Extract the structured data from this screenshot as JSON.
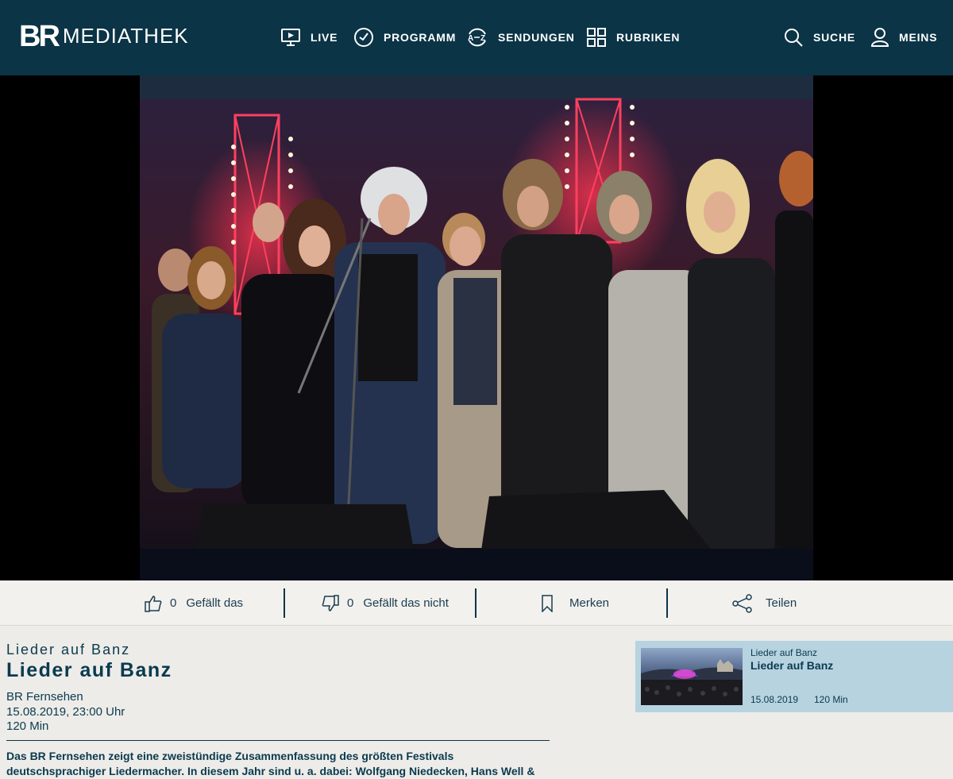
{
  "header": {
    "logo_br": "BR",
    "logo_text": "MEDIATHEK",
    "nav": [
      {
        "label": "LIVE",
        "icon": "live-tv-icon"
      },
      {
        "label": "PROGRAMM",
        "icon": "clock-icon"
      },
      {
        "label": "SENDUNGEN",
        "icon": "a-z-icon"
      },
      {
        "label": "RUBRIKEN",
        "icon": "grid-icon"
      }
    ],
    "search_label": "SUCHE",
    "account_label": "MEINS"
  },
  "actions": {
    "like_count": "0",
    "like_label": "Gefällt das",
    "dislike_count": "0",
    "dislike_label": "Gefällt das nicht",
    "bookmark_label": "Merken",
    "share_label": "Teilen"
  },
  "episode": {
    "kicker": "Lieder auf Banz",
    "title": "Lieder auf Banz",
    "channel": "BR Fernsehen",
    "airdate": "15.08.2019, 23:00 Uhr",
    "duration": "120 Min",
    "description": "Das BR Fernsehen zeigt eine zweistündige Zusammenfassung des größten Festivals deutschsprachiger Liedermacher. In diesem Jahr sind u. a. dabei: Wolfgang Niedecken, Hans Well &"
  },
  "related": {
    "kicker": "Lieder auf Banz",
    "title": "Lieder auf Banz",
    "date": "15.08.2019",
    "duration": "120 Min"
  },
  "colors": {
    "header_bg": "#0b3446",
    "page_bg": "#edece8",
    "card_bg": "#b7d3e0",
    "accent_blue": "#4aa3d8"
  }
}
